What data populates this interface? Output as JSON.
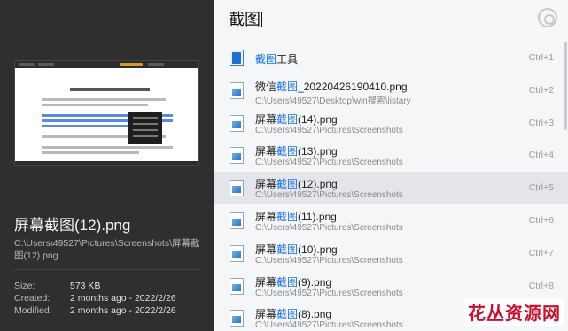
{
  "preview": {
    "file_name": "屏幕截图(12).png",
    "file_path": "C:\\Users\\49527\\Pictures\\Screenshots\\屏幕截图(12).png",
    "size_label": "Size:",
    "size_value": "573 KB",
    "created_label": "Created:",
    "created_value": "2 months ago - 2022/2/26",
    "modified_label": "Modified:",
    "modified_value": "2 months ago - 2022/2/26"
  },
  "search": {
    "query": "截图",
    "logo_icon": "listary-logo-icon"
  },
  "results": [
    {
      "pre": "",
      "kw": "截图",
      "post": "工具",
      "path": "",
      "hotkey": "Ctrl+1",
      "icon": "snipping-tool-icon",
      "selected": false
    },
    {
      "pre": "微信",
      "kw": "截图",
      "post": "_20220426190410.png",
      "path": "C:\\Users\\49527\\Desktop\\win搜索\\listary",
      "hotkey": "Ctrl+2",
      "icon": "png-file-icon",
      "selected": false
    },
    {
      "pre": "屏幕",
      "kw": "截图",
      "post": "(14).png",
      "path": "C:\\Users\\49527\\Pictures\\Screenshots",
      "hotkey": "Ctrl+3",
      "icon": "png-file-icon",
      "selected": false
    },
    {
      "pre": "屏幕",
      "kw": "截图",
      "post": "(13).png",
      "path": "C:\\Users\\49527\\Pictures\\Screenshots",
      "hotkey": "Ctrl+4",
      "icon": "png-file-icon",
      "selected": false
    },
    {
      "pre": "屏幕",
      "kw": "截图",
      "post": "(12).png",
      "path": "C:\\Users\\49527\\Pictures\\Screenshots",
      "hotkey": "Ctrl+5",
      "icon": "png-file-icon",
      "selected": true
    },
    {
      "pre": "屏幕",
      "kw": "截图",
      "post": "(11).png",
      "path": "C:\\Users\\49527\\Pictures\\Screenshots",
      "hotkey": "Ctrl+6",
      "icon": "png-file-icon",
      "selected": false
    },
    {
      "pre": "屏幕",
      "kw": "截图",
      "post": "(10).png",
      "path": "C:\\Users\\49527\\Pictures\\Screenshots",
      "hotkey": "Ctrl+7",
      "icon": "png-file-icon",
      "selected": false
    },
    {
      "pre": "屏幕",
      "kw": "截图",
      "post": "(9).png",
      "path": "C:\\Users\\49527\\Pictures\\Screenshots",
      "hotkey": "Ctrl+8",
      "icon": "png-file-icon",
      "selected": false
    },
    {
      "pre": "屏幕",
      "kw": "截图",
      "post": "(8).png",
      "path": "C:\\Users\\49527\\Pictures\\Screenshots",
      "hotkey": "",
      "icon": "png-file-icon",
      "selected": false
    }
  ],
  "colors": {
    "keyword_highlight": "#1a73e8",
    "left_pane_bg": "#2f2f2f",
    "selected_row_bg": "#e3e5ea",
    "watermark": "#c8102e"
  },
  "watermark": "花丛资源网"
}
